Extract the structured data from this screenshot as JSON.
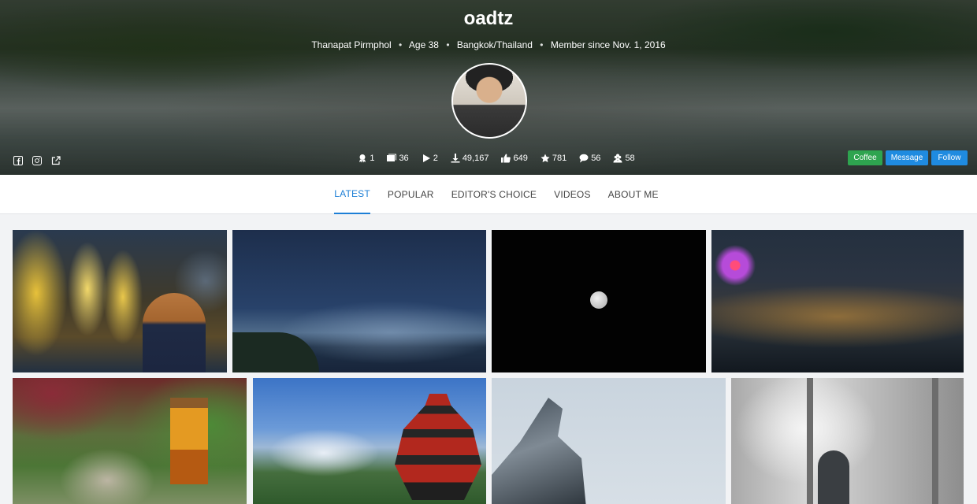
{
  "profile": {
    "username": "oadtz",
    "name": "Thanapat Pirmphol",
    "age": "Age 38",
    "location": "Bangkok/Thailand",
    "member_since": "Member since Nov. 1, 2016"
  },
  "stats": [
    {
      "icon": "awards-icon",
      "value": "1"
    },
    {
      "icon": "galleries-icon",
      "value": "36"
    },
    {
      "icon": "videos-icon",
      "value": "2"
    },
    {
      "icon": "downloads-icon",
      "value": "49,167"
    },
    {
      "icon": "likes-icon",
      "value": "649"
    },
    {
      "icon": "favorites-icon",
      "value": "781"
    },
    {
      "icon": "comments-icon",
      "value": "56"
    },
    {
      "icon": "followers-icon",
      "value": "58"
    }
  ],
  "social": [
    "facebook-icon",
    "instagram-icon",
    "external-link-icon"
  ],
  "actions": {
    "coffee": "Coffee",
    "message": "Message",
    "follow": "Follow"
  },
  "tabs": [
    {
      "label": "LATEST",
      "active": true
    },
    {
      "label": "POPULAR",
      "active": false
    },
    {
      "label": "EDITOR'S CHOICE",
      "active": false
    },
    {
      "label": "VIDEOS",
      "active": false
    },
    {
      "label": "ABOUT ME",
      "active": false
    }
  ],
  "colors": {
    "accent": "#1d7fd6",
    "coffee": "#2ea44f",
    "button": "#1f8be0"
  }
}
